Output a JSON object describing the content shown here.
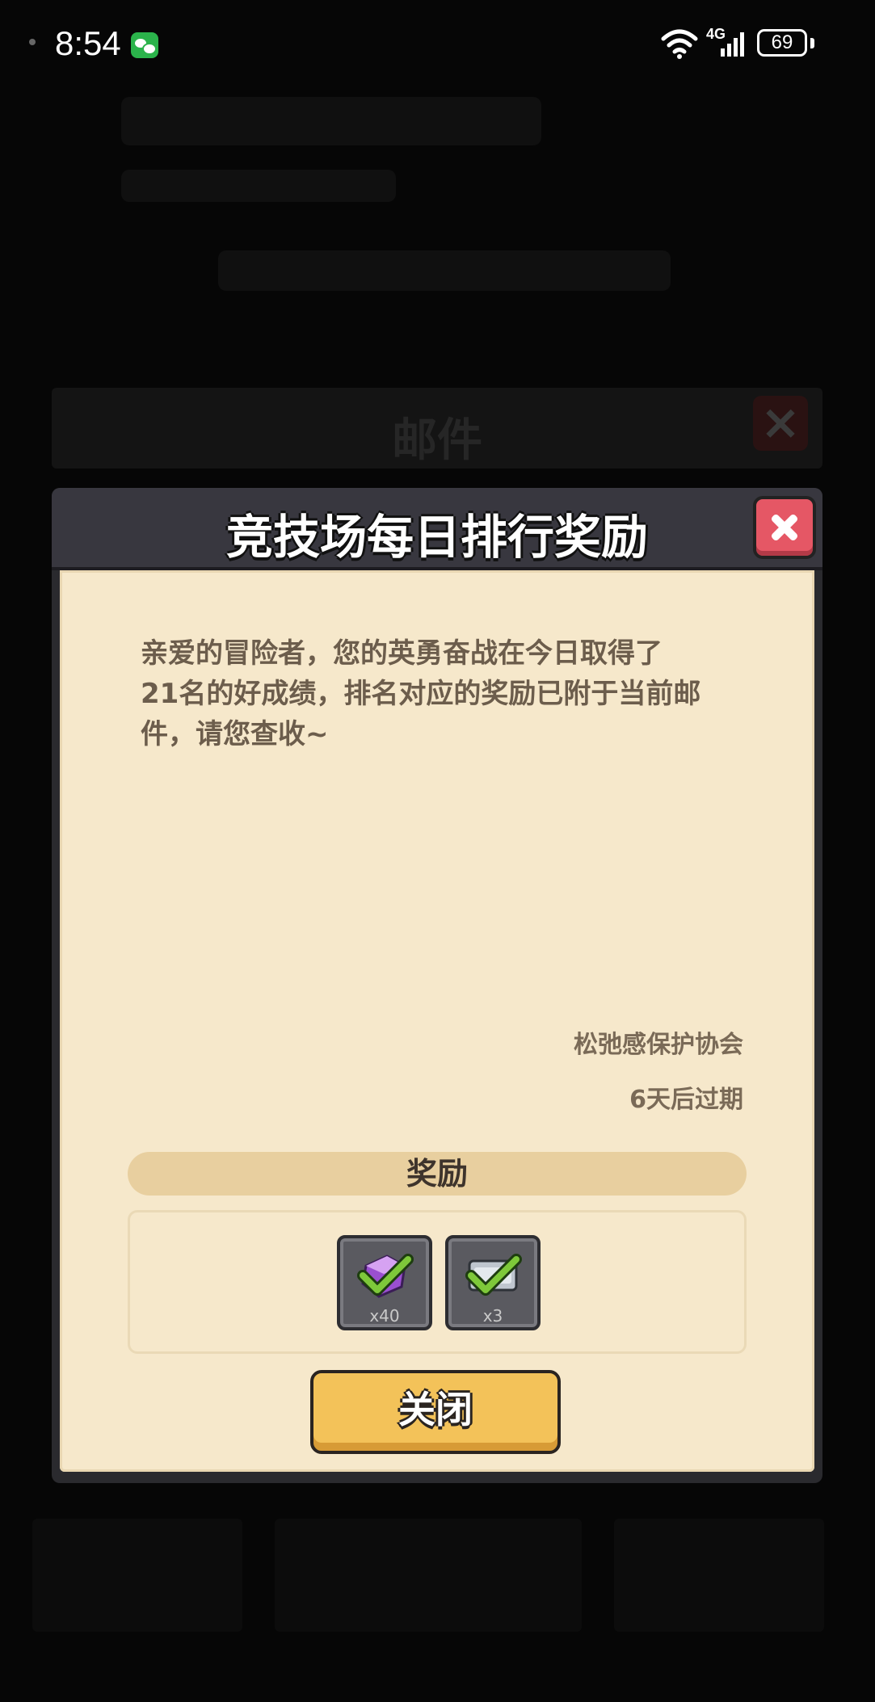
{
  "status_bar": {
    "time": "8:54",
    "network": "4G",
    "battery": "69"
  },
  "background": {
    "mail_title": "邮件"
  },
  "dialog": {
    "title": "竞技场每日排行奖励",
    "message_lines": [
      "亲爱的冒险者，您的英勇奋战在今日取得了",
      "21名的好成绩，排名对应的奖励已附于当前邮",
      "件，请您查收~"
    ],
    "sender": "松弛感保护协会",
    "expiry": "6天后过期",
    "rewards_label": "奖励",
    "rewards": [
      {
        "icon": "purple-gem-icon",
        "count": "x40",
        "claimed": true
      },
      {
        "icon": "silver-ticket-icon",
        "count": "x3",
        "claimed": true
      }
    ],
    "close_label": "关闭"
  },
  "colors": {
    "paper": "#f6e8cb",
    "header": "#38373f",
    "close_red": "#e55765",
    "button_gold": "#f3c259",
    "check_green": "#7ec83a"
  }
}
